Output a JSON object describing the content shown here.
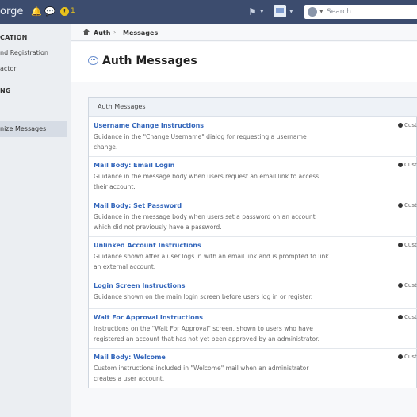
{
  "topbar": {
    "brand": "orge",
    "alert_count": "1",
    "warn_symbol": "!",
    "search": {
      "placeholder": "Search",
      "value": ""
    }
  },
  "sidebar": {
    "sections": [
      {
        "heading": "CATION",
        "items": [
          "nd Registration",
          "actor"
        ]
      },
      {
        "heading": "NG",
        "items": [
          "nize Messages"
        ]
      }
    ],
    "active_item": "nize Messages"
  },
  "breadcrumb": {
    "items": [
      "Auth",
      "Messages"
    ],
    "separator": "›"
  },
  "page": {
    "title": "Auth Messages"
  },
  "panel": {
    "header": "Auth Messages",
    "rows": [
      {
        "title": "Username Change Instructions",
        "desc": "Guidance in the \"Change Username\" dialog for requesting a username change.",
        "status": "Cust"
      },
      {
        "title": "Mail Body: Email Login",
        "desc": "Guidance in the message body when users request an email link to access their account.",
        "status": "Cust"
      },
      {
        "title": "Mail Body: Set Password",
        "desc": "Guidance in the message body when users set a password on an account which did not previously have a password.",
        "status": "Cust"
      },
      {
        "title": "Unlinked Account Instructions",
        "desc": "Guidance shown after a user logs in with an email link and is prompted to link an external account.",
        "status": "Cust"
      },
      {
        "title": "Login Screen Instructions",
        "desc": "Guidance shown on the main login screen before users log in or register.",
        "status": "Cust"
      },
      {
        "title": "Wait For Approval Instructions",
        "desc": "Instructions on the \"Wait For Approval\" screen, shown to users who have registered an account that has not yet been approved by an administrator.",
        "status": "Cust"
      },
      {
        "title": "Mail Body: Welcome",
        "desc": "Custom instructions included in \"Welcome\" mail when an administrator creates a user account.",
        "status": "Cust"
      }
    ]
  },
  "colors": {
    "topbar": "#3c4c6e",
    "link": "#3366bb",
    "accent": "#6a8fcf",
    "warn": "#e8c21c"
  }
}
